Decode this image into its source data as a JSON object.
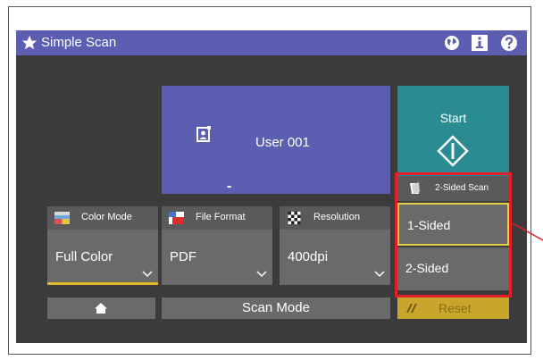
{
  "app": {
    "title": "Simple Scan"
  },
  "titlebar_icons": [
    "globe-icon",
    "info-icon",
    "help-icon"
  ],
  "user": {
    "name": "User 001",
    "subtext": "-"
  },
  "start": {
    "label": "Start"
  },
  "settings": [
    {
      "label": "Color Mode",
      "value": "Full Color",
      "icon": "color-mode-icon"
    },
    {
      "label": "File Format",
      "value": "PDF",
      "icon": "pdf-icon"
    },
    {
      "label": "Resolution",
      "value": "400dpi",
      "icon": "resolution-icon"
    }
  ],
  "two_sided": {
    "label": "2-Sided Scan",
    "options": [
      "1-Sided",
      "2-Sided"
    ],
    "selected": "1-Sided"
  },
  "bottom": {
    "scan_mode": "Scan Mode",
    "reset": "Reset"
  },
  "colors": {
    "title_bar": "#5c5fb1",
    "user_tile": "#5c5fb1",
    "start": "#2a8b93",
    "accent_yellow": "#e3b92a",
    "reset": "#c8a62c",
    "highlight_red": "#e41e26"
  }
}
